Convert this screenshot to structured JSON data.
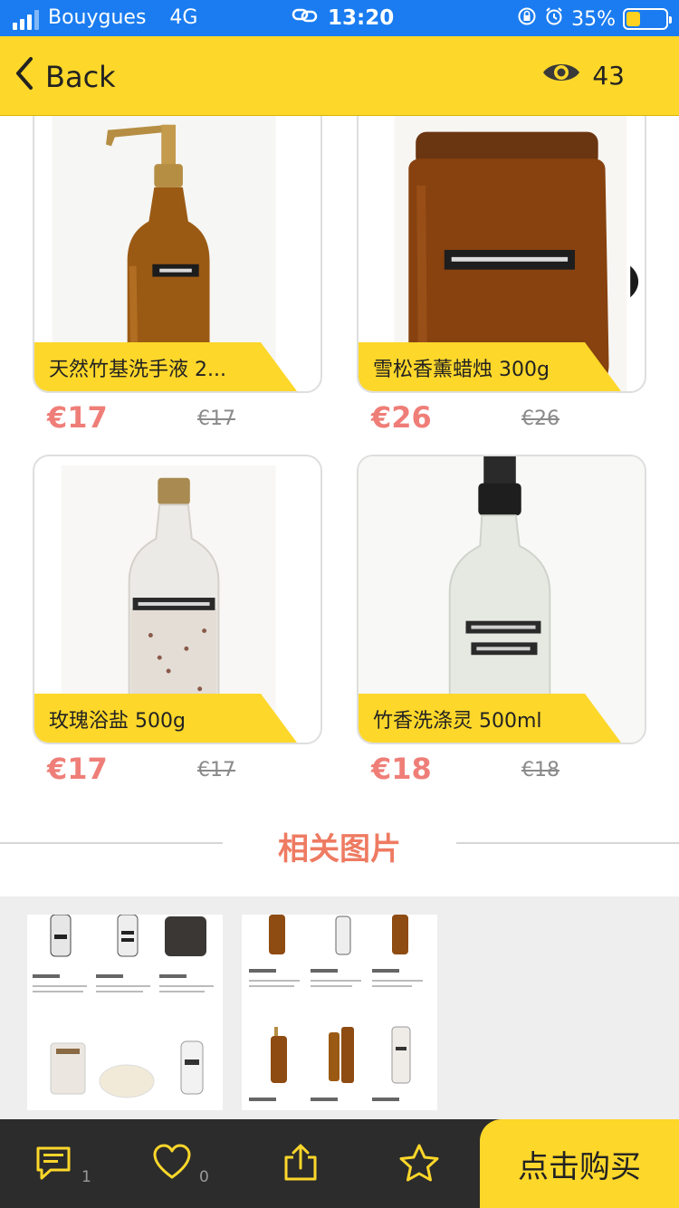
{
  "status_bar": {
    "carrier": "Bouygues",
    "network": "4G",
    "time": "13:20",
    "battery": "35%",
    "battery_level": 0.35
  },
  "nav": {
    "back_label": "Back",
    "view_count": "43"
  },
  "products": [
    {
      "name": "天然竹基洗手液 2...",
      "price": "€17",
      "old_price": "€17"
    },
    {
      "name": "雪松香薰蜡烛 300g",
      "price": "€26",
      "old_price": "€26"
    },
    {
      "name": "玫瑰浴盐 500g",
      "price": "€17",
      "old_price": "€17"
    },
    {
      "name": "竹香洗涤灵 500ml",
      "price": "€18",
      "old_price": "€18"
    }
  ],
  "section": {
    "title": "相关图片"
  },
  "bottom_bar": {
    "comment_count": "1",
    "like_count": "0",
    "buy_label": "点击购买"
  },
  "colors": {
    "accent_yellow": "#fdd72a",
    "price_red": "#ef7e78",
    "section_orange": "#ee7b62",
    "status_blue": "#1a7cf0",
    "bottom_bar_dark": "#2c2c2c"
  },
  "icons": [
    "signal-icon",
    "link-icon",
    "rotation-lock-icon",
    "alarm-icon",
    "battery-icon",
    "back-chevron-icon",
    "eye-icon",
    "comment-icon",
    "heart-icon",
    "share-icon",
    "star-icon"
  ]
}
